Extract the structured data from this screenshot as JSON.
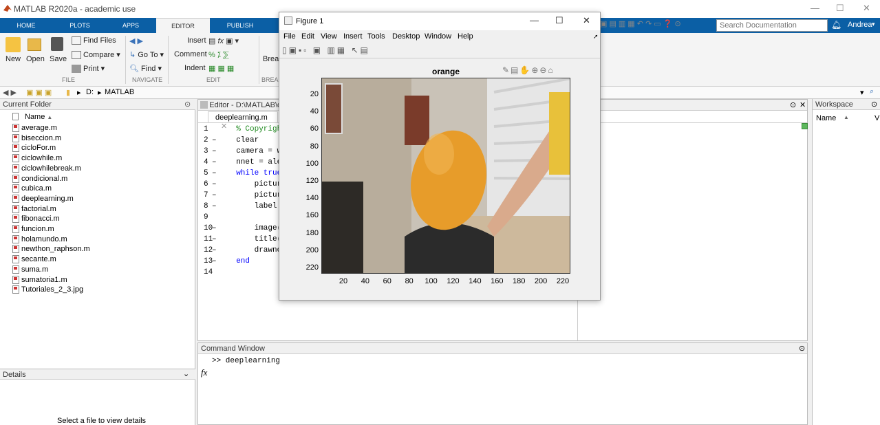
{
  "window": {
    "title": "MATLAB R2020a - academic use"
  },
  "tabs": [
    "HOME",
    "PLOTS",
    "APPS",
    "EDITOR",
    "PUBLISH"
  ],
  "user": "Andrea",
  "search": {
    "placeholder": "Search Documentation"
  },
  "toolstrip": {
    "new": "New",
    "open": "Open",
    "save": "Save",
    "find_files": "Find Files",
    "compare": "Compare",
    "print": "Print",
    "go_to": "Go To",
    "find": "Find",
    "insert": "Insert",
    "comment": "Comment",
    "indent": "Indent",
    "break": "Break",
    "groups": {
      "file": "FILE",
      "navigate": "NAVIGATE",
      "edit": "EDIT",
      "breakpoints": "BREAK"
    }
  },
  "address": {
    "drive": "D:",
    "folder": "MATLAB"
  },
  "current_folder": {
    "title": "Current Folder",
    "column": "Name",
    "files": [
      "average.m",
      "biseccion.m",
      "cicloFor.m",
      "ciclowhile.m",
      "ciclowhilebreak.m",
      "condicional.m",
      "cubica.m",
      "deeplearning.m",
      "factorial.m",
      "fibonacci.m",
      "funcion.m",
      "holamundo.m",
      "newthon_raphson.m",
      "secante.m",
      "suma.m",
      "sumatoria1.m",
      "Tutoriales_2_3.jpg"
    ]
  },
  "details": {
    "title": "Details",
    "message": "Select a file to view details"
  },
  "editor": {
    "title": "Editor - D:\\MATLAB\\de",
    "tab": "deeplearning.m",
    "lines": [
      {
        "n": "1",
        "t": "  % Copyrigh"
      },
      {
        "n": "2",
        "t": "  clear"
      },
      {
        "n": "3",
        "t": "  camera = w"
      },
      {
        "n": "4",
        "t": "  nnet = ale"
      },
      {
        "n": "5",
        "t": "  while true"
      },
      {
        "n": "6",
        "t": "      pictur"
      },
      {
        "n": "7",
        "t": "      pictur"
      },
      {
        "n": "8",
        "t": "      label "
      },
      {
        "n": "9",
        "t": ""
      },
      {
        "n": "10",
        "t": "      image("
      },
      {
        "n": "11",
        "t": "      title("
      },
      {
        "n": "12",
        "t": "      drawno"
      },
      {
        "n": "13",
        "t": "  end"
      },
      {
        "n": "14",
        "t": ""
      }
    ]
  },
  "command_window": {
    "title": "Command Window",
    "line": ">> deeplearning",
    "fx": "fx"
  },
  "workspace": {
    "title": "Workspace",
    "column": "Name",
    "col2": "V"
  },
  "figure": {
    "title": "Figure 1",
    "menu": [
      "File",
      "Edit",
      "View",
      "Insert",
      "Tools",
      "Desktop",
      "Window",
      "Help"
    ],
    "plot_title": "orange",
    "yticks": [
      "20",
      "40",
      "60",
      "80",
      "100",
      "120",
      "140",
      "160",
      "180",
      "200",
      "220"
    ],
    "xticks": [
      "20",
      "40",
      "60",
      "80",
      "100",
      "120",
      "140",
      "160",
      "180",
      "200",
      "220"
    ]
  }
}
